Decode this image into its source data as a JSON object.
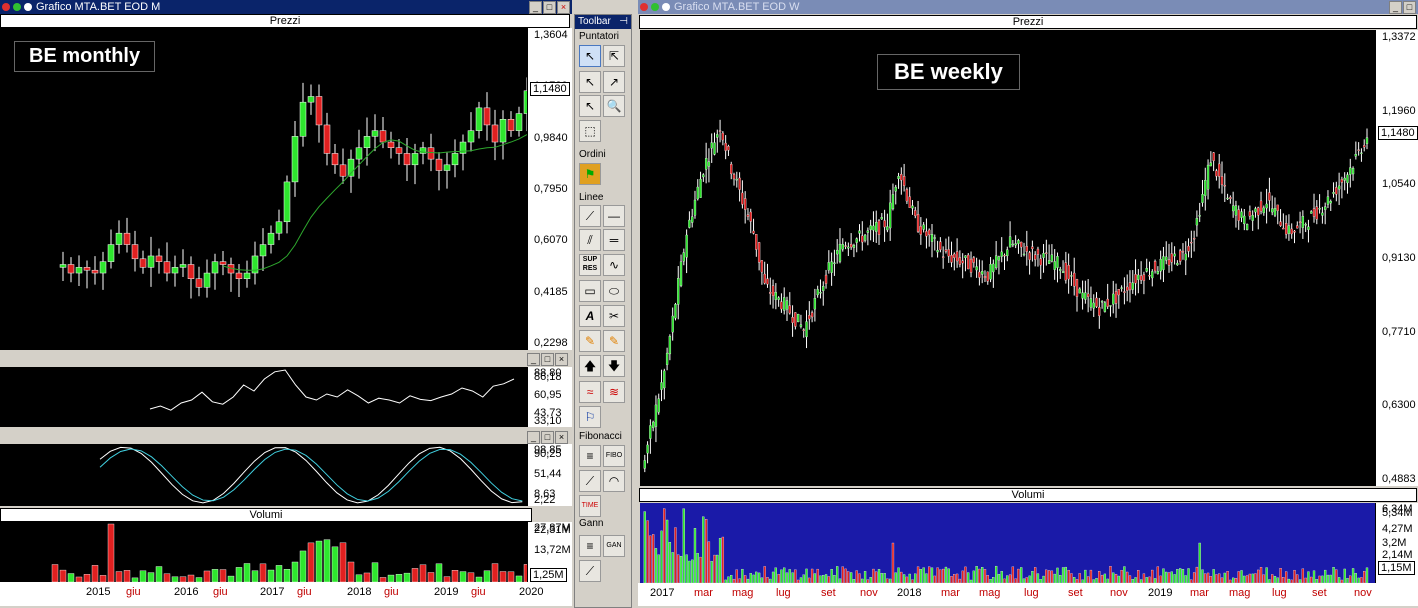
{
  "left_window": {
    "title": "Grafico MTA.BET EOD M",
    "chart_label": "BE monthly",
    "price_panel": {
      "title": "Prezzi",
      "y_ticks": [
        "1,3604",
        "1,1720",
        "0,9840",
        "0,7950",
        "0,6070",
        "0,4185",
        "0,2298"
      ],
      "last_price": "1,1480"
    },
    "rsi_panel": {
      "y_ticks": [
        "88,80",
        "86,18",
        "60,95",
        "43,73",
        "33,10"
      ]
    },
    "stoch_panel": {
      "y_ticks": [
        "98,85",
        "90,25",
        "51,44",
        "8,63",
        "2,22"
      ]
    },
    "volume_panel": {
      "title": "Volumi",
      "y_ticks": [
        "27,87M",
        "22,31M",
        "13,72M"
      ],
      "last_volume": "1,25M"
    },
    "x_labels": [
      {
        "t": "2015",
        "c": "#000"
      },
      {
        "t": "giu",
        "c": "#c00000"
      },
      {
        "t": "2016",
        "c": "#000"
      },
      {
        "t": "giu",
        "c": "#c00000"
      },
      {
        "t": "2017",
        "c": "#000"
      },
      {
        "t": "giu",
        "c": "#c00000"
      },
      {
        "t": "2018",
        "c": "#000"
      },
      {
        "t": "giu",
        "c": "#c00000"
      },
      {
        "t": "2019",
        "c": "#000"
      },
      {
        "t": "giu",
        "c": "#c00000"
      },
      {
        "t": "2020",
        "c": "#000"
      }
    ]
  },
  "right_window": {
    "title": "Grafico MTA.BET EOD W",
    "chart_label": "BE weekly",
    "price_panel": {
      "title": "Prezzi",
      "y_ticks": [
        "1,3372",
        "1,1960",
        "1,0540",
        "0,9130",
        "0,7710",
        "0,6300",
        "0,4883"
      ],
      "last_price": "1,1480"
    },
    "volume_panel": {
      "title": "Volumi",
      "y_ticks": [
        "6,34M",
        "5,34M",
        "4,27M",
        "3,2M",
        "2,14M"
      ],
      "last_volume": "1,15M"
    },
    "x_labels": [
      {
        "t": "2017",
        "c": "#000"
      },
      {
        "t": "mar",
        "c": "#c00000"
      },
      {
        "t": "mag",
        "c": "#c00000"
      },
      {
        "t": "lug",
        "c": "#c00000"
      },
      {
        "t": "set",
        "c": "#c00000"
      },
      {
        "t": "nov",
        "c": "#c00000"
      },
      {
        "t": "2018",
        "c": "#000"
      },
      {
        "t": "mar",
        "c": "#c00000"
      },
      {
        "t": "mag",
        "c": "#c00000"
      },
      {
        "t": "lug",
        "c": "#c00000"
      },
      {
        "t": "set",
        "c": "#c00000"
      },
      {
        "t": "nov",
        "c": "#c00000"
      },
      {
        "t": "2019",
        "c": "#000"
      },
      {
        "t": "mar",
        "c": "#c00000"
      },
      {
        "t": "mag",
        "c": "#c00000"
      },
      {
        "t": "lug",
        "c": "#c00000"
      },
      {
        "t": "set",
        "c": "#c00000"
      },
      {
        "t": "nov",
        "c": "#c00000"
      }
    ]
  },
  "toolbar": {
    "title": "Toolbar",
    "sections": {
      "pointers": "Puntatori",
      "orders": "Ordini",
      "lines": "Linee",
      "fibonacci": "Fibonacci",
      "gann": "Gann"
    },
    "sup_res": "SUP RES",
    "fibo": "FIBO",
    "time": "TIME",
    "gann_lbl": "GAN"
  },
  "colors": {
    "up": "#2ee62e",
    "down": "#e02020",
    "ma": "#2ea82e",
    "volume_bg": "#1a1aa8"
  }
}
